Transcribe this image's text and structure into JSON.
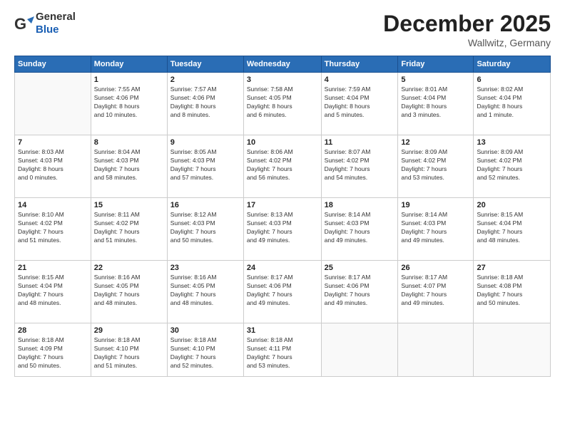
{
  "logo": {
    "general": "General",
    "blue": "Blue"
  },
  "header": {
    "month": "December 2025",
    "location": "Wallwitz, Germany"
  },
  "weekdays": [
    "Sunday",
    "Monday",
    "Tuesday",
    "Wednesday",
    "Thursday",
    "Friday",
    "Saturday"
  ],
  "weeks": [
    [
      {
        "day": "",
        "info": ""
      },
      {
        "day": "1",
        "info": "Sunrise: 7:55 AM\nSunset: 4:06 PM\nDaylight: 8 hours\nand 10 minutes."
      },
      {
        "day": "2",
        "info": "Sunrise: 7:57 AM\nSunset: 4:06 PM\nDaylight: 8 hours\nand 8 minutes."
      },
      {
        "day": "3",
        "info": "Sunrise: 7:58 AM\nSunset: 4:05 PM\nDaylight: 8 hours\nand 6 minutes."
      },
      {
        "day": "4",
        "info": "Sunrise: 7:59 AM\nSunset: 4:04 PM\nDaylight: 8 hours\nand 5 minutes."
      },
      {
        "day": "5",
        "info": "Sunrise: 8:01 AM\nSunset: 4:04 PM\nDaylight: 8 hours\nand 3 minutes."
      },
      {
        "day": "6",
        "info": "Sunrise: 8:02 AM\nSunset: 4:04 PM\nDaylight: 8 hours\nand 1 minute."
      }
    ],
    [
      {
        "day": "7",
        "info": "Sunrise: 8:03 AM\nSunset: 4:03 PM\nDaylight: 8 hours\nand 0 minutes."
      },
      {
        "day": "8",
        "info": "Sunrise: 8:04 AM\nSunset: 4:03 PM\nDaylight: 7 hours\nand 58 minutes."
      },
      {
        "day": "9",
        "info": "Sunrise: 8:05 AM\nSunset: 4:03 PM\nDaylight: 7 hours\nand 57 minutes."
      },
      {
        "day": "10",
        "info": "Sunrise: 8:06 AM\nSunset: 4:02 PM\nDaylight: 7 hours\nand 56 minutes."
      },
      {
        "day": "11",
        "info": "Sunrise: 8:07 AM\nSunset: 4:02 PM\nDaylight: 7 hours\nand 54 minutes."
      },
      {
        "day": "12",
        "info": "Sunrise: 8:09 AM\nSunset: 4:02 PM\nDaylight: 7 hours\nand 53 minutes."
      },
      {
        "day": "13",
        "info": "Sunrise: 8:09 AM\nSunset: 4:02 PM\nDaylight: 7 hours\nand 52 minutes."
      }
    ],
    [
      {
        "day": "14",
        "info": "Sunrise: 8:10 AM\nSunset: 4:02 PM\nDaylight: 7 hours\nand 51 minutes."
      },
      {
        "day": "15",
        "info": "Sunrise: 8:11 AM\nSunset: 4:02 PM\nDaylight: 7 hours\nand 51 minutes."
      },
      {
        "day": "16",
        "info": "Sunrise: 8:12 AM\nSunset: 4:03 PM\nDaylight: 7 hours\nand 50 minutes."
      },
      {
        "day": "17",
        "info": "Sunrise: 8:13 AM\nSunset: 4:03 PM\nDaylight: 7 hours\nand 49 minutes."
      },
      {
        "day": "18",
        "info": "Sunrise: 8:14 AM\nSunset: 4:03 PM\nDaylight: 7 hours\nand 49 minutes."
      },
      {
        "day": "19",
        "info": "Sunrise: 8:14 AM\nSunset: 4:03 PM\nDaylight: 7 hours\nand 49 minutes."
      },
      {
        "day": "20",
        "info": "Sunrise: 8:15 AM\nSunset: 4:04 PM\nDaylight: 7 hours\nand 48 minutes."
      }
    ],
    [
      {
        "day": "21",
        "info": "Sunrise: 8:15 AM\nSunset: 4:04 PM\nDaylight: 7 hours\nand 48 minutes."
      },
      {
        "day": "22",
        "info": "Sunrise: 8:16 AM\nSunset: 4:05 PM\nDaylight: 7 hours\nand 48 minutes."
      },
      {
        "day": "23",
        "info": "Sunrise: 8:16 AM\nSunset: 4:05 PM\nDaylight: 7 hours\nand 48 minutes."
      },
      {
        "day": "24",
        "info": "Sunrise: 8:17 AM\nSunset: 4:06 PM\nDaylight: 7 hours\nand 49 minutes."
      },
      {
        "day": "25",
        "info": "Sunrise: 8:17 AM\nSunset: 4:06 PM\nDaylight: 7 hours\nand 49 minutes."
      },
      {
        "day": "26",
        "info": "Sunrise: 8:17 AM\nSunset: 4:07 PM\nDaylight: 7 hours\nand 49 minutes."
      },
      {
        "day": "27",
        "info": "Sunrise: 8:18 AM\nSunset: 4:08 PM\nDaylight: 7 hours\nand 50 minutes."
      }
    ],
    [
      {
        "day": "28",
        "info": "Sunrise: 8:18 AM\nSunset: 4:09 PM\nDaylight: 7 hours\nand 50 minutes."
      },
      {
        "day": "29",
        "info": "Sunrise: 8:18 AM\nSunset: 4:10 PM\nDaylight: 7 hours\nand 51 minutes."
      },
      {
        "day": "30",
        "info": "Sunrise: 8:18 AM\nSunset: 4:10 PM\nDaylight: 7 hours\nand 52 minutes."
      },
      {
        "day": "31",
        "info": "Sunrise: 8:18 AM\nSunset: 4:11 PM\nDaylight: 7 hours\nand 53 minutes."
      },
      {
        "day": "",
        "info": ""
      },
      {
        "day": "",
        "info": ""
      },
      {
        "day": "",
        "info": ""
      }
    ]
  ]
}
